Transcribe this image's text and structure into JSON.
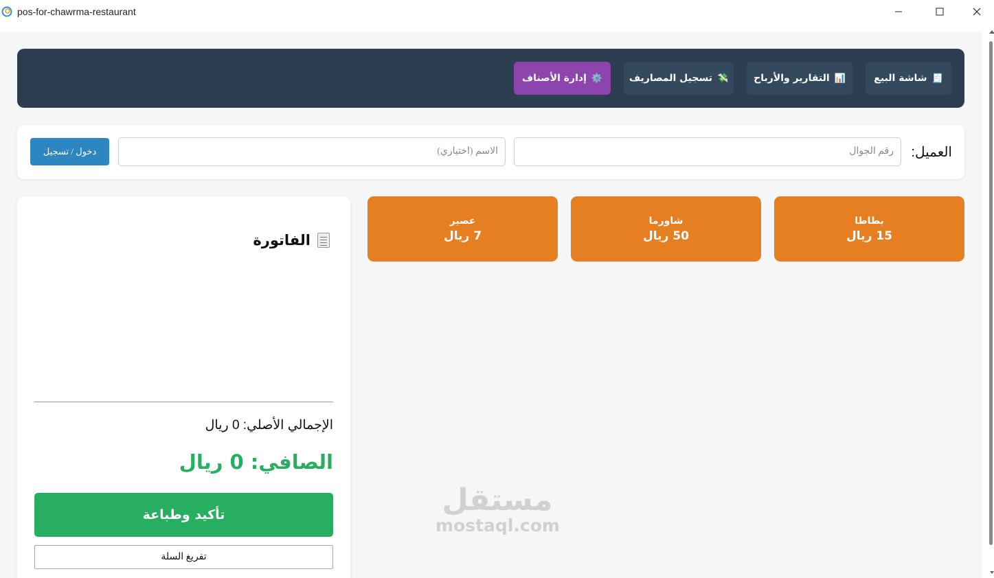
{
  "window": {
    "title": "pos-for-chawrma-restaurant",
    "icons": [
      "app-icon",
      "minimize-icon",
      "maximize-icon",
      "close-icon"
    ]
  },
  "nav": {
    "items": [
      {
        "label": "شاشة البيع",
        "icon": "🧾",
        "active": false
      },
      {
        "label": "التقارير والأرباح",
        "icon": "📊",
        "active": false
      },
      {
        "label": "تسجيل المصاريف",
        "icon": "💸",
        "active": false
      },
      {
        "label": "إدارة الأصناف",
        "icon": "⚙️",
        "active": true
      }
    ]
  },
  "customer": {
    "label": "العميل:",
    "phone_placeholder": "رقم الجوال",
    "name_placeholder": "الاسم (اختياري)",
    "login_label": "دخول / تسجيل"
  },
  "products": [
    {
      "name": "بطاطا",
      "price": "15 ريال"
    },
    {
      "name": "شاورما",
      "price": "50 ريال"
    },
    {
      "name": "عصير",
      "price": "7 ريال"
    }
  ],
  "invoice": {
    "title": "الفاتورة",
    "icon": "receipt-icon",
    "original_total": "الإجمالي الأصلي: 0 ريال",
    "net_total": "الصافي: 0 ريال",
    "confirm_label": "تأكيد وطباعة",
    "clear_label": "تفريغ السلة"
  },
  "watermark": {
    "arabic": "مستقل",
    "latin": "mostaql.com"
  },
  "colors": {
    "nav_bg": "#2c3e50",
    "nav_button": "#34495e",
    "nav_active": "#8e44ad",
    "product": "#e67e22",
    "confirm": "#27ae60",
    "net_total": "#27ae60",
    "login": "#2e86c1",
    "page_bg": "#f4f6f7"
  }
}
